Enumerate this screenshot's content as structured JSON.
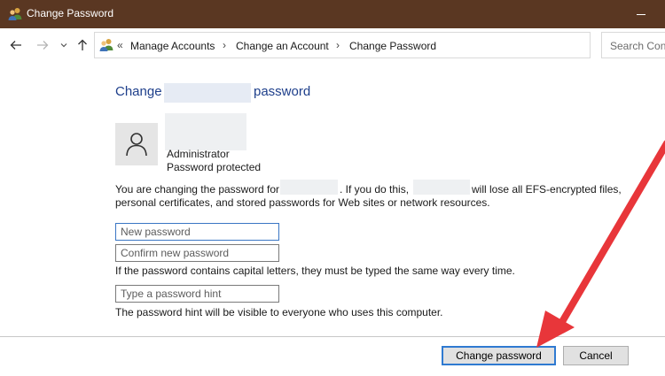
{
  "window": {
    "title": "Change Password"
  },
  "address_bar": {
    "overflow_glyph": "«",
    "breadcrumb": [
      "Manage Accounts",
      "Change an Account",
      "Change Password"
    ],
    "separator": "›"
  },
  "search": {
    "placeholder": "Search Conl"
  },
  "content": {
    "heading_prefix": "Change",
    "heading_suffix": "password",
    "account_type": "Administrator",
    "account_status": "Password protected",
    "warning_part1": "You are changing the password for",
    "warning_part2": ". If you do this,",
    "warning_part3": "will lose all EFS-encrypted files,",
    "warning_line2": "personal certificates, and stored passwords for Web sites or network resources.",
    "new_password_placeholder": "New password",
    "confirm_password_placeholder": "Confirm new password",
    "capital_letters_note": "If the password contains capital letters, they must be typed the same way every time.",
    "hint_placeholder": "Type a password hint",
    "hint_note": "The password hint will be visible to everyone who uses this computer."
  },
  "buttons": {
    "change_password": "Change password",
    "cancel": "Cancel"
  },
  "colors": {
    "titlebar": "#5a3722",
    "heading": "#1e3f8b",
    "annotation_arrow": "#e8363a"
  },
  "icons": {
    "title": "users-icon",
    "back": "back-arrow-icon",
    "forward": "forward-arrow-icon",
    "recent": "chevron-down-icon",
    "up": "up-arrow-icon",
    "address": "users-icon",
    "refresh": "refresh-icon",
    "avatar": "user-icon"
  }
}
